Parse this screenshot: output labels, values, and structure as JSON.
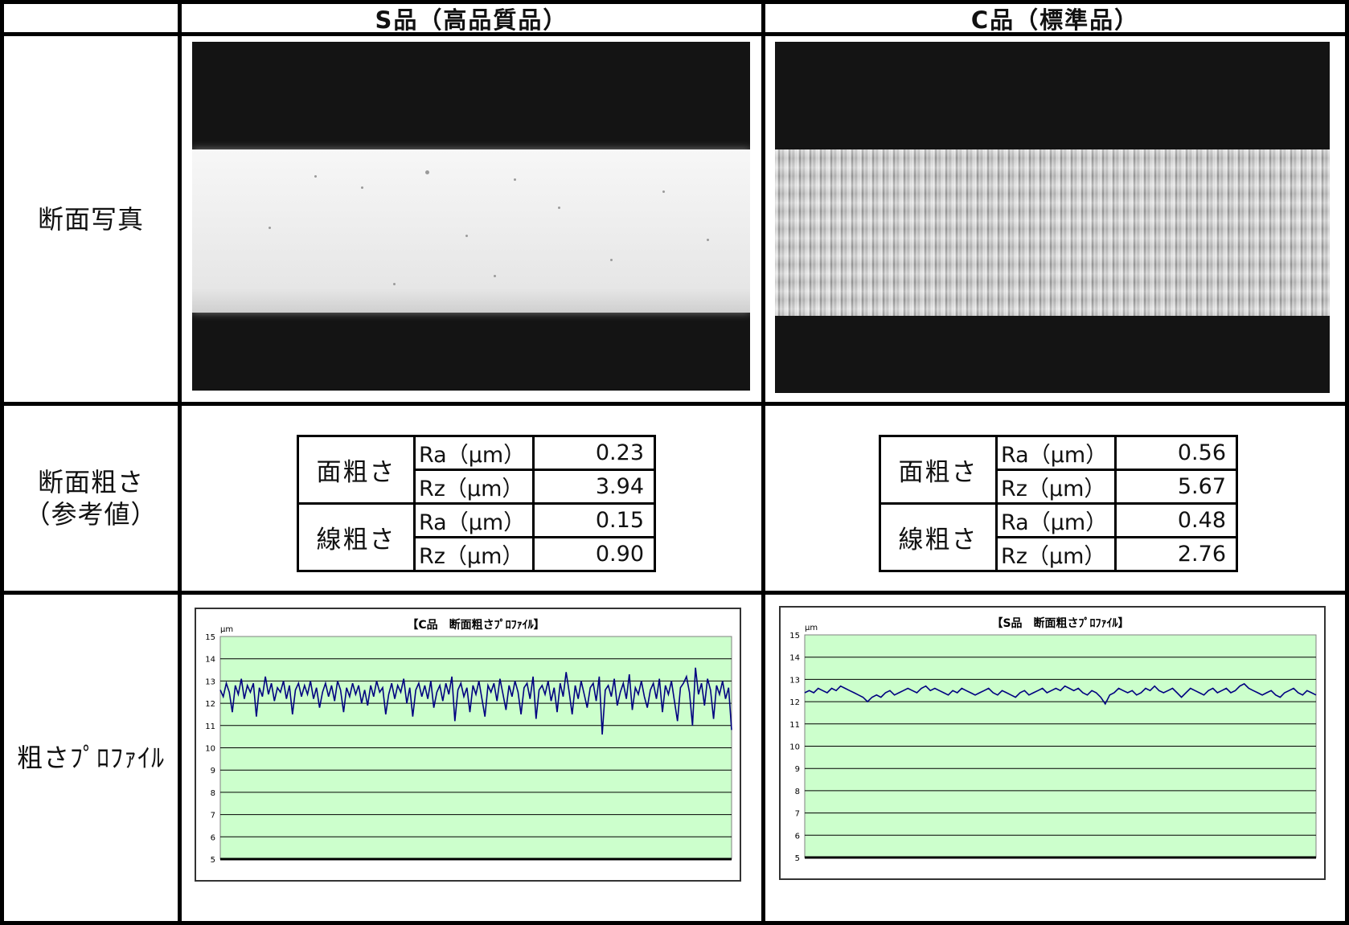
{
  "headers": {
    "col1": "S品（高品質品）",
    "col2": "C品（標準品）"
  },
  "rows": {
    "photo_label": "断面写真",
    "roughness_label_line1": "断面粗さ",
    "roughness_label_line2": "（参考値）",
    "profile_label": "粗さﾌﾟﾛﾌｧｲﾙ"
  },
  "roughness_tables": [
    {
      "rows": [
        {
          "group": "面粗さ",
          "param": "Ra（μm）",
          "value": "0.23"
        },
        {
          "param": "Rz（μm）",
          "value": "3.94"
        },
        {
          "group": "線粗さ",
          "param": "Ra（μm）",
          "value": "0.15"
        },
        {
          "param": "Rz（μm）",
          "value": "0.90"
        }
      ]
    },
    {
      "rows": [
        {
          "group": "面粗さ",
          "param": "Ra（μm）",
          "value": "0.56"
        },
        {
          "param": "Rz（μm）",
          "value": "5.67"
        },
        {
          "group": "線粗さ",
          "param": "Ra（μm）",
          "value": "0.48"
        },
        {
          "param": "Rz（μm）",
          "value": "2.76"
        }
      ]
    }
  ],
  "chart_data": [
    {
      "type": "line",
      "title": "【C品　断面粗さﾌﾟﾛﾌｧｲﾙ】",
      "ylabel": "μm",
      "ylim": [
        5,
        15
      ],
      "yticks": [
        "5",
        "6",
        "7",
        "8",
        "9",
        "10",
        "11",
        "12",
        "13",
        "14",
        "15"
      ],
      "grid": true,
      "plot_bg": "#ccffcc",
      "line_color": "#000080",
      "series": [
        {
          "values": [
            12.6,
            12.3,
            12.9,
            12.5,
            11.6,
            12.8,
            12.4,
            13.1,
            12.2,
            12.8,
            12.5,
            12.9,
            11.4,
            12.7,
            12.3,
            13.2,
            12.4,
            12.9,
            12.1,
            12.7,
            12.5,
            13.0,
            12.2,
            12.8,
            11.5,
            12.6,
            12.9,
            12.3,
            12.8,
            12.4,
            13.0,
            12.2,
            12.7,
            11.8,
            12.5,
            12.9,
            12.3,
            12.8,
            12.1,
            13.0,
            12.6,
            11.6,
            12.7,
            12.3,
            12.9,
            12.4,
            12.8,
            12.0,
            12.6,
            11.9,
            12.8,
            12.3,
            13.0,
            12.5,
            12.7,
            11.5,
            12.4,
            12.9,
            12.2,
            12.8,
            12.5,
            13.1,
            12.0,
            12.7,
            11.4,
            12.6,
            12.9,
            12.3,
            12.8,
            12.2,
            13.0,
            11.8,
            12.5,
            12.8,
            12.1,
            12.9,
            12.4,
            13.2,
            11.2,
            12.6,
            12.9,
            12.3,
            12.7,
            11.6,
            12.8,
            12.4,
            13.0,
            12.2,
            11.4,
            12.8,
            12.5,
            12.9,
            12.1,
            13.1,
            12.4,
            11.7,
            12.8,
            12.3,
            13.0,
            12.5,
            11.5,
            12.7,
            12.9,
            12.2,
            13.2,
            11.3,
            12.6,
            12.8,
            12.4,
            13.0,
            12.1,
            12.7,
            11.6,
            12.9,
            12.3,
            13.4,
            12.5,
            11.5,
            12.8,
            12.2,
            13.0,
            12.4,
            11.8,
            12.7,
            12.9,
            12.1,
            13.2,
            10.6,
            12.6,
            12.8,
            12.3,
            13.1,
            11.9,
            12.5,
            12.9,
            12.2,
            13.3,
            11.7,
            12.7,
            12.4,
            13.0,
            12.3,
            11.8,
            12.6,
            12.9,
            12.2,
            13.1,
            11.6,
            12.8,
            12.4,
            13.0,
            12.1,
            11.2,
            12.7,
            12.9,
            13.2,
            12.5,
            11.0,
            13.6,
            12.4,
            12.9,
            11.9,
            13.1,
            12.6,
            11.3,
            12.8,
            12.4,
            13.0,
            12.2,
            12.7,
            10.8
          ]
        }
      ]
    },
    {
      "type": "line",
      "title": "【S品　断面粗さﾌﾟﾛﾌｧｲﾙ】",
      "ylabel": "μm",
      "ylim": [
        5,
        15
      ],
      "yticks": [
        "5",
        "6",
        "7",
        "8",
        "9",
        "10",
        "11",
        "12",
        "13",
        "14",
        "15"
      ],
      "grid": true,
      "plot_bg": "#ccffcc",
      "line_color": "#000080",
      "series": [
        {
          "values": [
            12.4,
            12.5,
            12.4,
            12.6,
            12.5,
            12.4,
            12.6,
            12.5,
            12.7,
            12.6,
            12.5,
            12.4,
            12.3,
            12.2,
            12.0,
            12.2,
            12.3,
            12.2,
            12.4,
            12.5,
            12.3,
            12.4,
            12.5,
            12.6,
            12.5,
            12.4,
            12.6,
            12.7,
            12.5,
            12.6,
            12.5,
            12.4,
            12.3,
            12.5,
            12.4,
            12.6,
            12.5,
            12.4,
            12.3,
            12.4,
            12.5,
            12.6,
            12.4,
            12.3,
            12.5,
            12.4,
            12.3,
            12.2,
            12.4,
            12.5,
            12.3,
            12.4,
            12.5,
            12.6,
            12.4,
            12.5,
            12.6,
            12.5,
            12.7,
            12.6,
            12.5,
            12.6,
            12.4,
            12.3,
            12.5,
            12.4,
            12.2,
            11.9,
            12.3,
            12.4,
            12.6,
            12.5,
            12.4,
            12.5,
            12.3,
            12.4,
            12.6,
            12.5,
            12.7,
            12.5,
            12.4,
            12.5,
            12.6,
            12.4,
            12.2,
            12.4,
            12.6,
            12.5,
            12.4,
            12.3,
            12.5,
            12.6,
            12.4,
            12.5,
            12.6,
            12.4,
            12.5,
            12.7,
            12.8,
            12.6,
            12.5,
            12.4,
            12.3,
            12.4,
            12.5,
            12.3,
            12.2,
            12.4,
            12.5,
            12.6,
            12.4,
            12.3,
            12.5,
            12.4,
            12.3
          ]
        }
      ]
    }
  ]
}
